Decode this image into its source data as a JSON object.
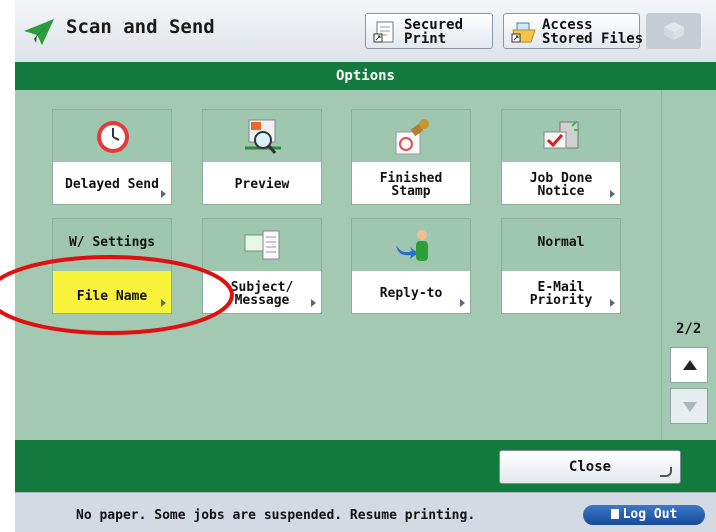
{
  "header": {
    "title": "Scan and Send",
    "secured_print": "Secured\nPrint",
    "access_stored_files": "Access\nStored Files"
  },
  "options": {
    "title": "Options",
    "items": [
      {
        "label": "Delayed Send",
        "icon": "clock-icon",
        "has_arrow": true
      },
      {
        "label": "Preview",
        "icon": "preview-magnifier-icon",
        "has_arrow": false
      },
      {
        "label": "Finished\nStamp",
        "icon": "stamp-icon",
        "has_arrow": false
      },
      {
        "label": "Job Done\nNotice",
        "icon": "job-done-notice-icon",
        "has_arrow": true
      },
      {
        "label": "File Name",
        "setting": "W/ Settings",
        "has_arrow": true,
        "selected": true
      },
      {
        "label": "Subject/\nMessage",
        "icon": "message-icon",
        "has_arrow": true
      },
      {
        "label": "Reply-to",
        "icon": "reply-to-person-icon",
        "has_arrow": true
      },
      {
        "label": "E-Mail\nPriority",
        "setting": "Normal",
        "has_arrow": true
      }
    ]
  },
  "pager": {
    "indicator": "2/2"
  },
  "footer": {
    "close": "Close"
  },
  "status": {
    "message": "No paper. Some jobs are suspended. Resume printing.",
    "logout": "Log Out"
  },
  "colors": {
    "green_bar": "#117a3c",
    "options_bg": "#a3c9b3",
    "selected_yellow": "#f8f33a",
    "annotation_red": "#e01010",
    "logout_blue": "#1f5aa8"
  }
}
